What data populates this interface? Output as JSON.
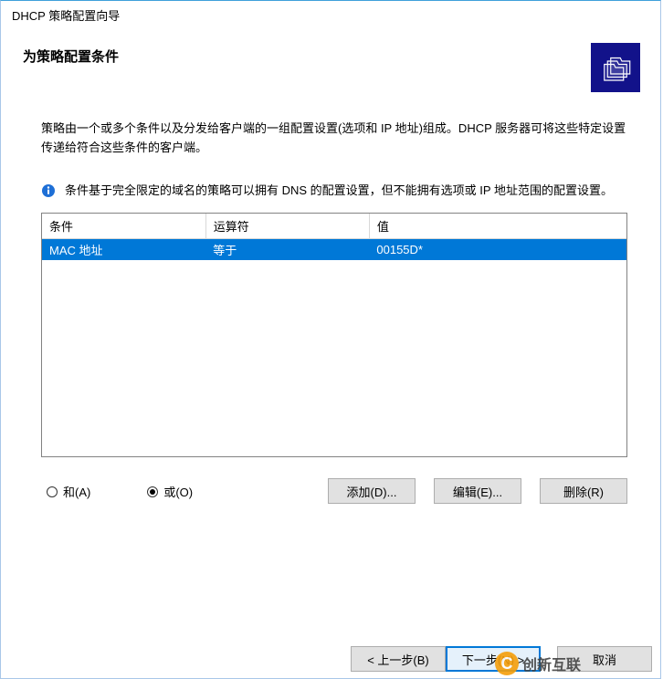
{
  "window": {
    "title": "DHCP 策略配置向导"
  },
  "page": {
    "heading": "为策略配置条件",
    "description": "策略由一个或多个条件以及分发给客户端的一组配置设置(选项和 IP 地址)组成。DHCP 服务器可将这些特定设置传递给符合这些条件的客户端。",
    "info": "条件基于完全限定的域名的策略可以拥有 DNS 的配置设置，但不能拥有选项或 IP 地址范围的配置设置。"
  },
  "table": {
    "headers": {
      "condition": "条件",
      "operator": "运算符",
      "value": "值"
    },
    "rows": [
      {
        "condition": "MAC 地址",
        "operator": "等于",
        "value": "00155D*",
        "selected": true
      }
    ]
  },
  "radios": {
    "and": "和(A)",
    "or": "或(O)",
    "selected": "or"
  },
  "buttons": {
    "add": "添加(D)...",
    "edit": "编辑(E)...",
    "delete": "删除(R)",
    "back": "< 上一步(B)",
    "next": "下一步(N) >",
    "cancel": "取消"
  },
  "watermark": "创新互联"
}
